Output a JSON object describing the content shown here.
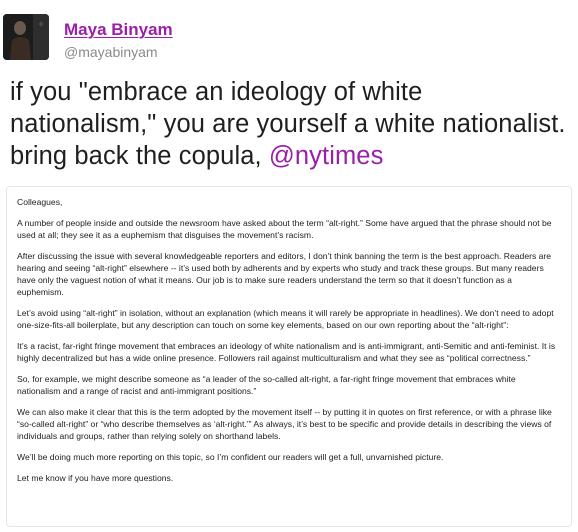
{
  "tweet": {
    "author_name": "Maya Binyam",
    "author_handle": "@mayabinyam",
    "text_before_mention": "if you \"embrace an ideology of white nationalism,\" you are yourself a white nationalist. bring back the copula, ",
    "mention": "@nytimes",
    "accent_color": "#9b1fa8"
  },
  "memo": {
    "paragraphs": [
      "Colleagues,",
      "A number of people inside and outside the newsroom have asked about the term “alt-right.” Some have argued that the phrase should not be used at all; they see it as a euphemism that disguises the movement’s racism.",
      "After discussing the issue with several knowledgeable reporters and editors, I don’t think banning the term is the best approach. Readers are hearing and seeing “alt-right” elsewhere -- it’s used both by adherents and by experts who study and track these groups. But many readers have only the vaguest notion of what it means. Our job is to make sure readers understand the term so that it doesn’t function as a euphemism.",
      "Let’s avoid using “alt-right” in isolation, without an explanation (which means it will rarely be appropriate in headlines). We don’t need to adopt one-size-fits-all boilerplate, but any description can touch on some key elements, based on our own reporting about the “alt-right”:",
      "It’s a racist, far-right fringe movement that embraces an ideology of white nationalism and is anti-immigrant, anti-Semitic and anti-feminist. It is highly decentralized but has a wide online presence. Followers rail against multiculturalism and what they see as “political correctness.”",
      "So, for example, we might describe someone as “a leader of the so-called alt-right, a far-right fringe movement that embraces white nationalism and a range of racist and anti-immigrant positions.”",
      "We can also make it clear that this is the term adopted by the movement itself -- by putting it in quotes on first reference, or with a phrase like “so-called alt-right” or “who describe themselves as ‘alt-right.’” As always, it’s best to be specific and provide details in describing the views of individuals and groups, rather than relying solely on shorthand labels.",
      "We’ll be doing much more reporting on this topic, so I’m confident our readers will get a full, unvarnished picture.",
      "Let me know if you have more questions."
    ]
  }
}
